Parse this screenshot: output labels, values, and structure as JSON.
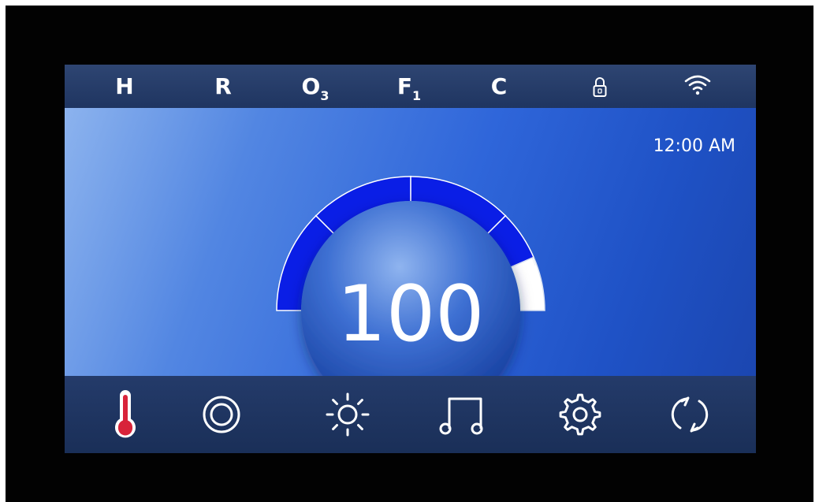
{
  "status_bar": {
    "heater": "H",
    "r_indicator": "R",
    "ozone": {
      "main": "O",
      "sub": "3"
    },
    "filter": {
      "main": "F",
      "sub": "1"
    },
    "c_indicator": "C",
    "lock_icon": "lock-icon",
    "wifi_icon": "wifi-icon"
  },
  "main": {
    "time": "12:00 AM",
    "temperature": "100",
    "temperature_dial": {
      "set_point_fraction": 0.87,
      "segments": 4,
      "colors": {
        "active": "#0a1ee6",
        "remaining": "#ffffff",
        "marker": "#0c1b3a"
      }
    }
  },
  "nav": [
    {
      "name": "temperature",
      "icon": "thermometer-icon"
    },
    {
      "name": "jets",
      "icon": "jets-icon"
    },
    {
      "name": "light",
      "icon": "sun-icon"
    },
    {
      "name": "music",
      "icon": "music-note-icon"
    },
    {
      "name": "settings",
      "icon": "gear-icon"
    },
    {
      "name": "cycle",
      "icon": "refresh-icon"
    }
  ],
  "colors": {
    "thermometer_fill": "#d8233a",
    "icon_stroke": "#ffffff"
  }
}
